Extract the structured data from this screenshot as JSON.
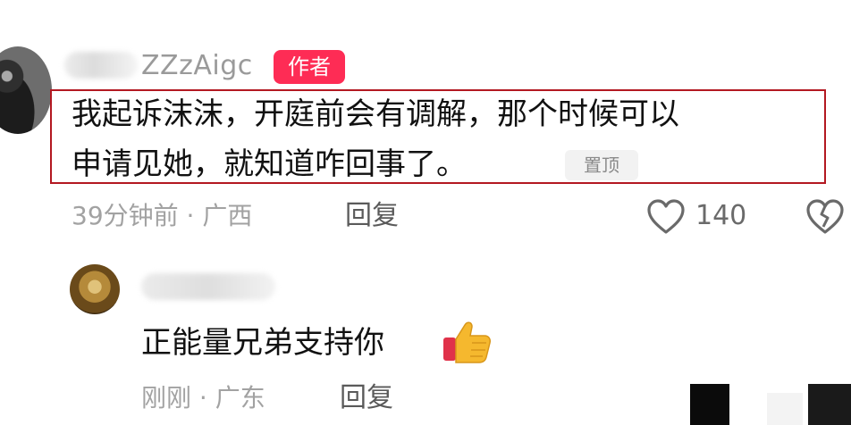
{
  "comment1": {
    "username": "ZZzAigc",
    "author_badge": "作者",
    "line1": "我起诉沫沫，开庭前会有调解，那个时候可以",
    "line2": "申请见她，就知道咋回事了。",
    "pin_badge": "置顶",
    "meta": "39分钟前 · 广西",
    "reply": "回复",
    "like_count": "140"
  },
  "comment2": {
    "text": "正能量兄弟支持你",
    "meta": "刚刚 · 广东",
    "reply": "回复"
  },
  "colors": {
    "accent": "#fe2c55",
    "highlight_box": "#b31821"
  },
  "icons": [
    "heart-icon",
    "broken-heart-icon",
    "thumbs-up-emoji"
  ]
}
